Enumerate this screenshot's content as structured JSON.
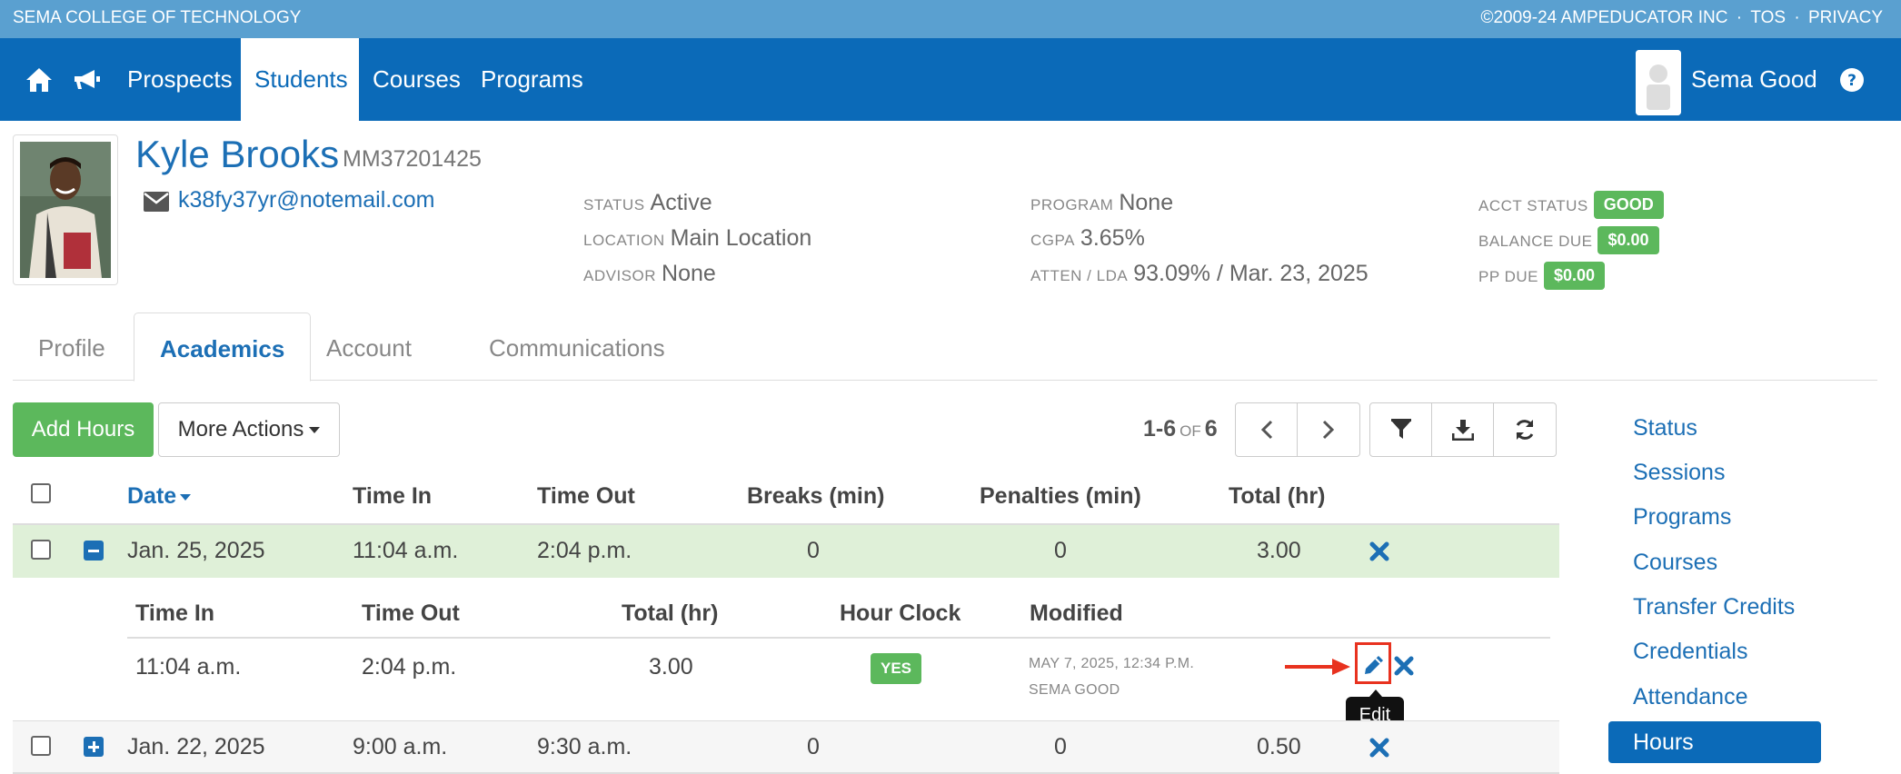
{
  "topbar": {
    "school": "SEMA COLLEGE OF TECHNOLOGY",
    "copyright": "©2009-24 AMPEDUCATOR INC",
    "sep": "·",
    "tos": "TOS",
    "privacy": "PRIVACY"
  },
  "nav": {
    "items": [
      "Prospects",
      "Students",
      "Courses",
      "Programs"
    ],
    "active": "Students",
    "user": "Sema Good"
  },
  "student": {
    "name": "Kyle Brooks",
    "id": "MM37201425",
    "email": "k38fy37yr@notemail.com",
    "status_label": "STATUS",
    "status": "Active",
    "location_label": "LOCATION",
    "location": "Main Location",
    "advisor_label": "ADVISOR",
    "advisor": "None",
    "program_label": "PROGRAM",
    "program": "None",
    "cgpa_label": "CGPA",
    "cgpa": "3.65%",
    "atten_label": "ATTEN / LDA",
    "atten": "93.09% / Mar. 23, 2025",
    "acct_label": "ACCT STATUS",
    "acct": "GOOD",
    "balance_label": "BALANCE DUE",
    "balance": "$0.00",
    "pp_label": "PP DUE",
    "pp": "$0.00"
  },
  "tabs": [
    "Profile",
    "Academics",
    "Account",
    "Communications"
  ],
  "toolbar": {
    "add_hours": "Add Hours",
    "more_actions": "More Actions",
    "range": "1-6",
    "of": "OF",
    "total": "6"
  },
  "table": {
    "headers": [
      "Date",
      "Time In",
      "Time Out",
      "Breaks (min)",
      "Penalties (min)",
      "Total (hr)"
    ],
    "rows": [
      {
        "date": "Jan. 25, 2025",
        "in": "11:04 a.m.",
        "out": "2:04 p.m.",
        "breaks": "0",
        "penalties": "0",
        "total": "3.00"
      },
      {
        "date": "Jan. 22, 2025",
        "in": "9:00 a.m.",
        "out": "9:30 a.m.",
        "breaks": "0",
        "penalties": "0",
        "total": "0.50"
      }
    ],
    "sub": {
      "headers": [
        "Time In",
        "Time Out",
        "Total (hr)",
        "Hour Clock",
        "Modified"
      ],
      "row": {
        "in": "11:04 a.m.",
        "out": "2:04 p.m.",
        "total": "3.00",
        "clock": "YES",
        "modified_date": "MAY 7, 2025, 12:34 P.M.",
        "modified_by": "SEMA GOOD"
      }
    },
    "tooltip": "Edit"
  },
  "sidebar": {
    "items": [
      "Status",
      "Sessions",
      "Programs",
      "Courses",
      "Transfer Credits",
      "Credentials",
      "Attendance",
      "Hours"
    ],
    "active": "Hours"
  },
  "colors": {
    "nav_blue": "#0b6ab8",
    "topbar_blue": "#5aa0d0",
    "link_blue": "#1c6fb5",
    "green": "#5cb85c",
    "highlight_red": "#e8321f"
  }
}
